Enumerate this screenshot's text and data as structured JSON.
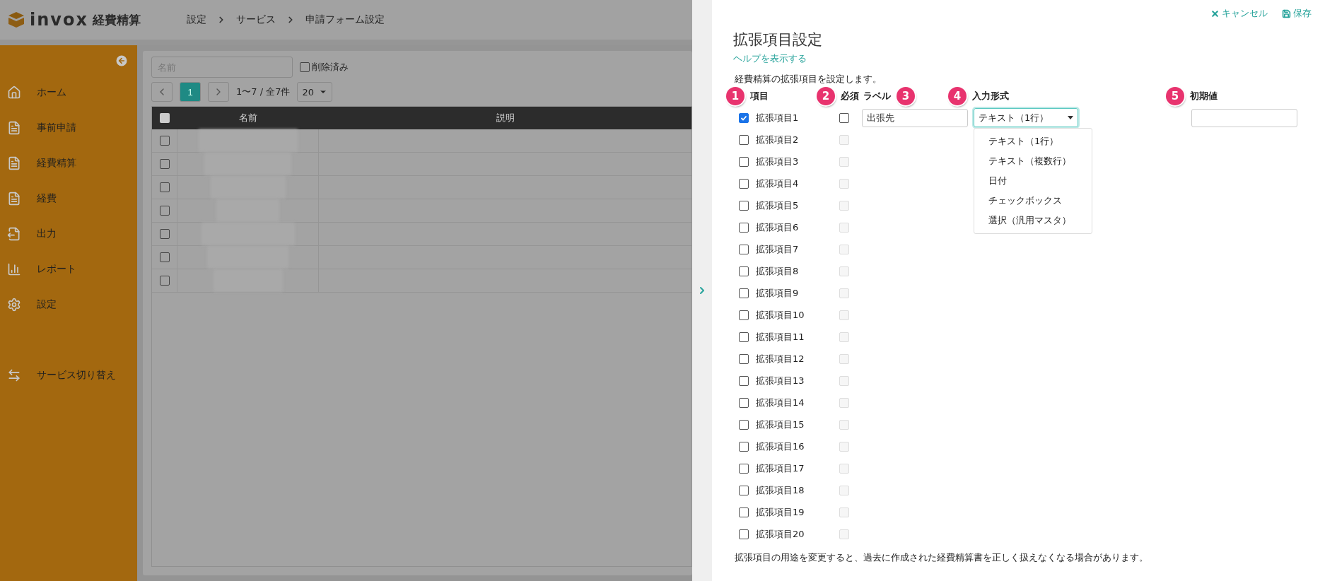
{
  "header": {
    "brand": "invox",
    "product": "経費精算",
    "breadcrumb": [
      "設定",
      "サービス",
      "申請フォーム設定"
    ]
  },
  "sidebar": {
    "items": [
      {
        "label": "ホーム"
      },
      {
        "label": "事前申請"
      },
      {
        "label": "経費精算"
      },
      {
        "label": "経費"
      },
      {
        "label": "出力"
      },
      {
        "label": "レポート"
      },
      {
        "label": "設定"
      }
    ],
    "footer_item": {
      "label": "サービス切り替え"
    }
  },
  "list": {
    "search": {
      "placeholder": "名前"
    },
    "deleted_filter": {
      "label": "削除済み",
      "checked": false
    },
    "pagination": {
      "pages": [
        {
          "label": "1",
          "selected": true
        }
      ],
      "range": "1〜7 / 全7件",
      "page_size": "20"
    },
    "table": {
      "select_all_checked": false,
      "columns": [
        "名前",
        "説明"
      ],
      "rows": [
        {
          "checked": false
        },
        {
          "checked": false
        },
        {
          "checked": false
        },
        {
          "checked": false
        },
        {
          "checked": false
        },
        {
          "checked": false
        },
        {
          "checked": false
        }
      ]
    }
  },
  "panel": {
    "actions": [
      {
        "kind": "cancel",
        "label": "キャンセル"
      },
      {
        "kind": "save",
        "label": "保存"
      }
    ],
    "title": "拡張項目設定",
    "help_link": "ヘルプを表示する",
    "description": "経費精算の拡張項目を設定します。",
    "columns": [
      {
        "marker": "1",
        "label": "項目"
      },
      {
        "marker": "2",
        "label": "必須"
      },
      {
        "marker": "3",
        "label": "ラベル"
      },
      {
        "marker": "4",
        "label": "入力形式"
      },
      {
        "marker": "5",
        "label": "初期値"
      }
    ],
    "fields": [
      {
        "name": "拡張項目1",
        "enabled": true,
        "required": false,
        "label_value": "出張先",
        "input_type": "テキスト（1行）",
        "expanded": true
      },
      {
        "name": "拡張項目2",
        "enabled": false,
        "required": false
      },
      {
        "name": "拡張項目3",
        "enabled": false,
        "required": false
      },
      {
        "name": "拡張項目4",
        "enabled": false,
        "required": false
      },
      {
        "name": "拡張項目5",
        "enabled": false,
        "required": false
      },
      {
        "name": "拡張項目6",
        "enabled": false,
        "required": false
      },
      {
        "name": "拡張項目7",
        "enabled": false,
        "required": false
      },
      {
        "name": "拡張項目8",
        "enabled": false,
        "required": false
      },
      {
        "name": "拡張項目9",
        "enabled": false,
        "required": false
      },
      {
        "name": "拡張項目10",
        "enabled": false,
        "required": false
      },
      {
        "name": "拡張項目11",
        "enabled": false,
        "required": false
      },
      {
        "name": "拡張項目12",
        "enabled": false,
        "required": false
      },
      {
        "name": "拡張項目13",
        "enabled": false,
        "required": false
      },
      {
        "name": "拡張項目14",
        "enabled": false,
        "required": false
      },
      {
        "name": "拡張項目15",
        "enabled": false,
        "required": false
      },
      {
        "name": "拡張項目16",
        "enabled": false,
        "required": false
      },
      {
        "name": "拡張項目17",
        "enabled": false,
        "required": false
      },
      {
        "name": "拡張項目18",
        "enabled": false,
        "required": false
      },
      {
        "name": "拡張項目19",
        "enabled": false,
        "required": false
      },
      {
        "name": "拡張項目20",
        "enabled": false,
        "required": false
      }
    ],
    "type_options": [
      "テキスト（1行）",
      "テキスト（複数行）",
      "日付",
      "チェックボックス",
      "選択（汎用マスタ）"
    ],
    "note": "拡張項目の用途を変更すると、過去に作成された経費精算書を正しく扱えなくなる場合があります。"
  }
}
